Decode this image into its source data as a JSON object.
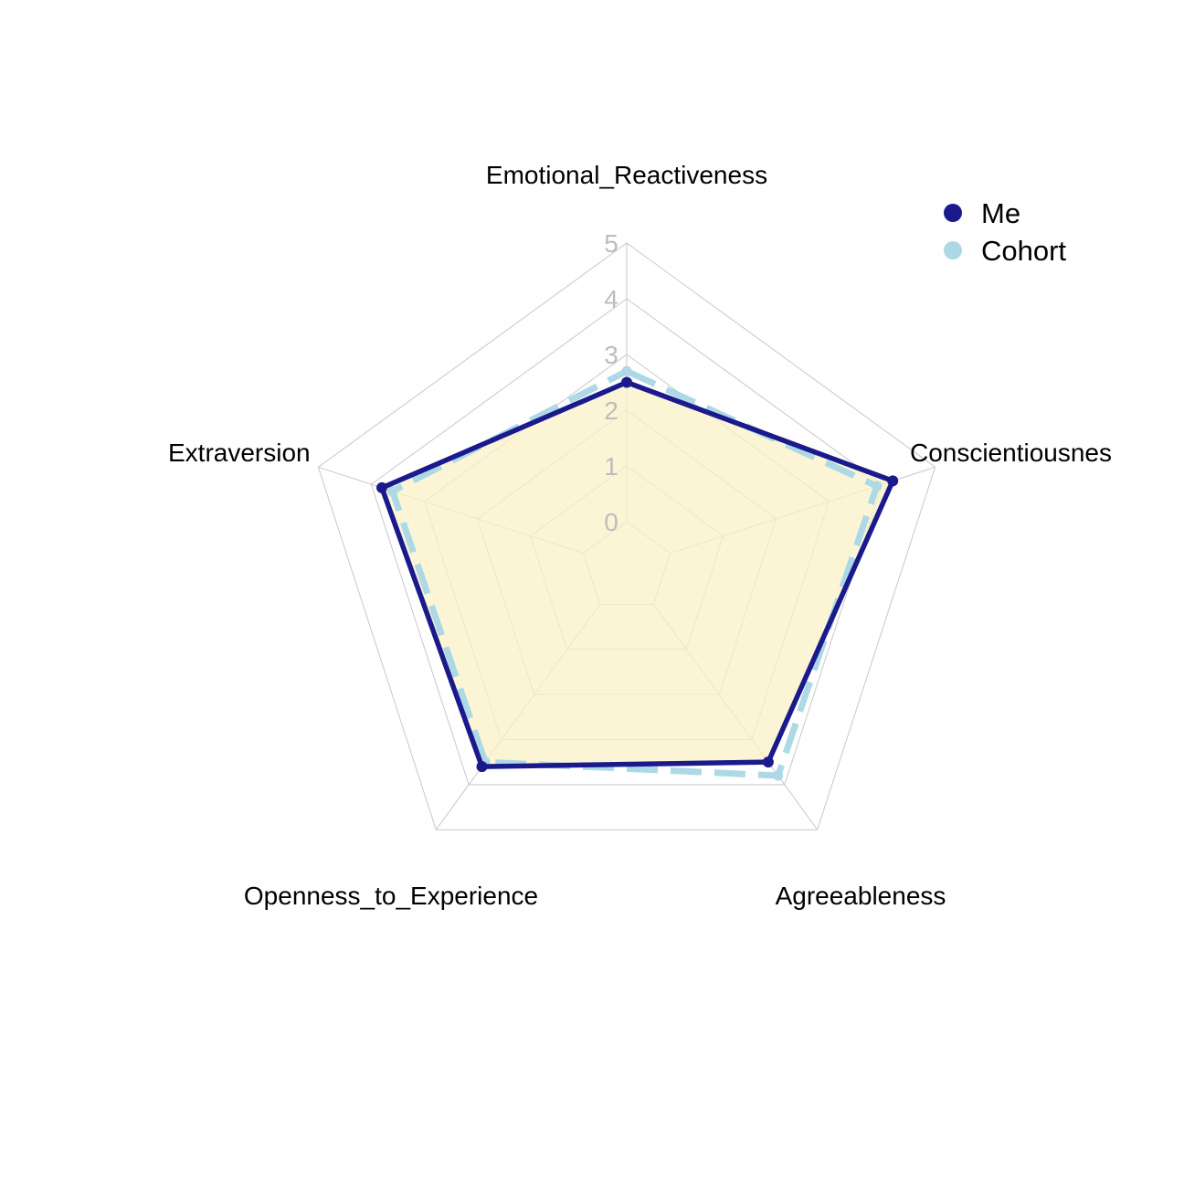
{
  "chart_data": {
    "type": "radar",
    "axes": [
      "Emotional_Reactiveness",
      "Conscientiousnes",
      "Agreeableness",
      "Openness_to_Experience",
      "Extraversion"
    ],
    "rlim": [
      0,
      5
    ],
    "ticks": [
      "0",
      "1",
      "2",
      "3",
      "4",
      "5"
    ],
    "legend_position": "top-right",
    "series": [
      {
        "name": "Me",
        "values": [
          2.5,
          4.2,
          3.5,
          3.6,
          3.8
        ],
        "color": "#1a1a8c",
        "line": "solid",
        "fill": "#f9f1c8"
      },
      {
        "name": "Cohort",
        "values": [
          2.7,
          3.9,
          3.8,
          3.5,
          3.6
        ],
        "color": "#add8e6",
        "line": "dashed"
      }
    ]
  }
}
